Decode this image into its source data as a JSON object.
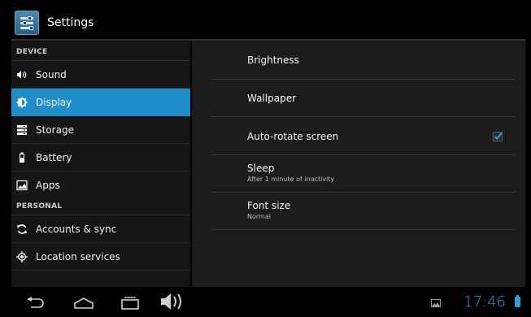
{
  "action_bar": {
    "title": "Settings"
  },
  "sidebar": {
    "device_header": "DEVICE",
    "personal_header": "PERSONAL",
    "items": [
      {
        "label": "Sound",
        "icon": "speaker-icon"
      },
      {
        "label": "Display",
        "icon": "brightness-icon",
        "selected": true
      },
      {
        "label": "Storage",
        "icon": "storage-icon"
      },
      {
        "label": "Battery",
        "icon": "battery-icon"
      },
      {
        "label": "Apps",
        "icon": "apps-icon"
      },
      {
        "label": "Accounts & sync",
        "icon": "sync-icon"
      },
      {
        "label": "Location services",
        "icon": "location-icon"
      }
    ]
  },
  "display": {
    "brightness": {
      "title": "Brightness"
    },
    "wallpaper": {
      "title": "Wallpaper"
    },
    "auto_rotate": {
      "title": "Auto-rotate screen",
      "checked": true
    },
    "sleep": {
      "title": "Sleep",
      "summary": "After 1 minute of inactivity"
    },
    "font_size": {
      "title": "Font size",
      "summary": "Normal"
    }
  },
  "status_bar": {
    "time": "17:46"
  },
  "colors": {
    "accent": "#1f8dc7",
    "clock": "#2f9fd9"
  }
}
